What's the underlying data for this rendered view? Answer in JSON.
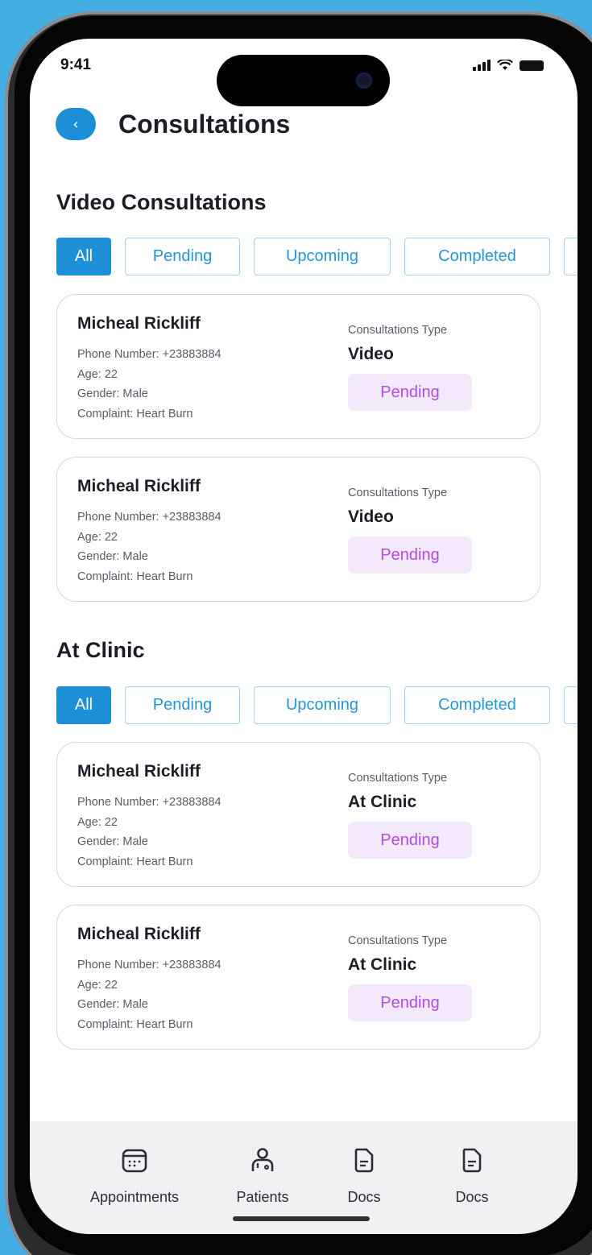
{
  "status_bar": {
    "time": "9:41"
  },
  "header": {
    "back_icon": "chevron-left-icon",
    "title": "Consultations"
  },
  "video_section": {
    "title": "Video Consultations",
    "filters": [
      "All",
      "Pending",
      "Upcoming",
      "Completed"
    ],
    "active_filter": "All",
    "cards": [
      {
        "name": "Micheal Rickliff",
        "phone": "Phone Number: +23883884",
        "age": "Age: 22",
        "gender": "Gender: Male",
        "complaint": "Complaint: Heart Burn",
        "type_label": "Consultations Type",
        "type_value": "Video",
        "status": "Pending"
      },
      {
        "name": "Micheal Rickliff",
        "phone": "Phone Number: +23883884",
        "age": "Age: 22",
        "gender": "Gender: Male",
        "complaint": "Complaint: Heart Burn",
        "type_label": "Consultations Type",
        "type_value": "Video",
        "status": "Pending"
      }
    ]
  },
  "clinic_section": {
    "title": "At Clinic",
    "filters": [
      "All",
      "Pending",
      "Upcoming",
      "Completed"
    ],
    "active_filter": "All",
    "cards": [
      {
        "name": "Micheal Rickliff",
        "phone": "Phone Number: +23883884",
        "age": "Age: 22",
        "gender": "Gender: Male",
        "complaint": "Complaint: Heart Burn",
        "type_label": "Consultations Type",
        "type_value": "At Clinic",
        "status": "Pending"
      },
      {
        "name": "Micheal Rickliff",
        "phone": "Phone Number: +23883884",
        "age": "Age: 22",
        "gender": "Gender: Male",
        "complaint": "Complaint: Heart Burn",
        "type_label": "Consultations Type",
        "type_value": "At Clinic",
        "status": "Pending"
      }
    ]
  },
  "bottom_nav": [
    {
      "label": "Appointments",
      "icon": "calendar-icon"
    },
    {
      "label": "Patients",
      "icon": "patients-icon"
    },
    {
      "label": "Docs",
      "icon": "document-icon"
    },
    {
      "label": "Docs",
      "icon": "document-icon"
    }
  ],
  "colors": {
    "background": "#45aee3",
    "accent": "#1c8fd6",
    "badge_bg": "#f3e9fb",
    "badge_text": "#b04de0"
  }
}
